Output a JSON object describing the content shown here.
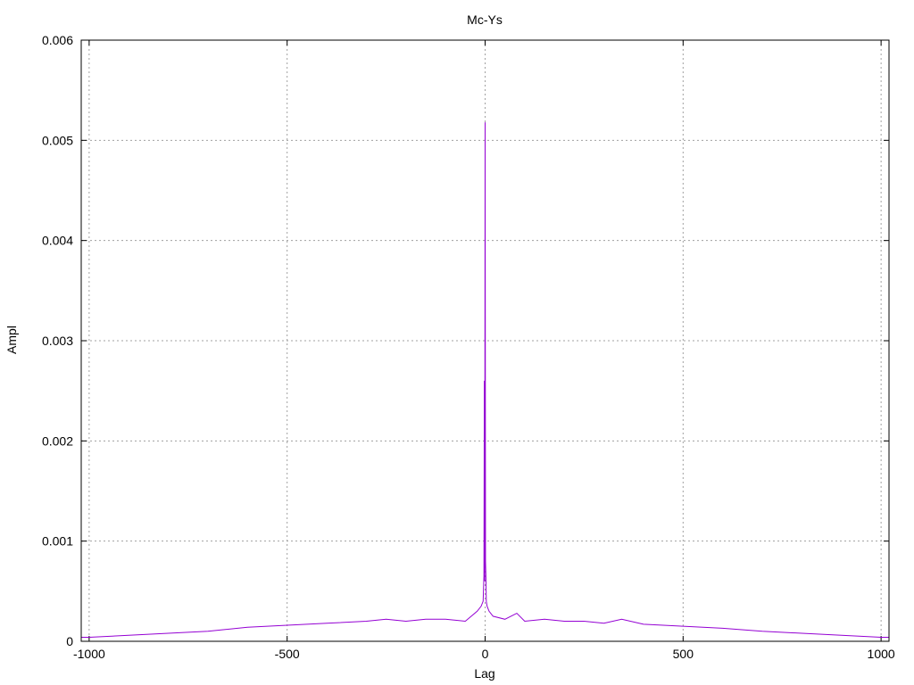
{
  "chart_data": {
    "type": "line",
    "title": "Mc-Ys",
    "xlabel": "Lag",
    "ylabel": "Ampl",
    "xlim": [
      -1020,
      1020
    ],
    "ylim": [
      0,
      0.006
    ],
    "grid": true,
    "x_ticks": [
      -1000,
      -500,
      0,
      500,
      1000
    ],
    "x_tick_labels": [
      "-1000",
      "-500",
      "0",
      "500",
      "1000"
    ],
    "y_ticks": [
      0,
      0.001,
      0.002,
      0.003,
      0.004,
      0.005,
      0.006
    ],
    "y_tick_labels": [
      "0",
      "0.001",
      "0.002",
      "0.003",
      "0.004",
      "0.005",
      "0.006"
    ],
    "series_color": "#9400d3",
    "series": [
      {
        "x": [
          -1020,
          -1000,
          -900,
          -800,
          -700,
          -600,
          -500,
          -400,
          -300,
          -250,
          -200,
          -150,
          -100,
          -50,
          -20,
          -10,
          -5,
          -3,
          -2,
          -1,
          0,
          1,
          2,
          3,
          5,
          10,
          20,
          50,
          80,
          100,
          150,
          200,
          250,
          300,
          345,
          400,
          500,
          600,
          700,
          800,
          900,
          1000,
          1020
        ],
        "values": [
          4e-05,
          4e-05,
          6e-05,
          8e-05,
          0.0001,
          0.00014,
          0.00016,
          0.00018,
          0.0002,
          0.00022,
          0.0002,
          0.00022,
          0.00022,
          0.0002,
          0.0003,
          0.00035,
          0.0004,
          0.00065,
          0.0026,
          0.0006,
          0.00518,
          0.0008,
          0.00065,
          0.0004,
          0.00035,
          0.0003,
          0.00025,
          0.00022,
          0.00028,
          0.0002,
          0.00022,
          0.0002,
          0.0002,
          0.00018,
          0.00022,
          0.00017,
          0.00015,
          0.00013,
          0.0001,
          8e-05,
          6e-05,
          4e-05,
          4e-05
        ]
      }
    ]
  }
}
